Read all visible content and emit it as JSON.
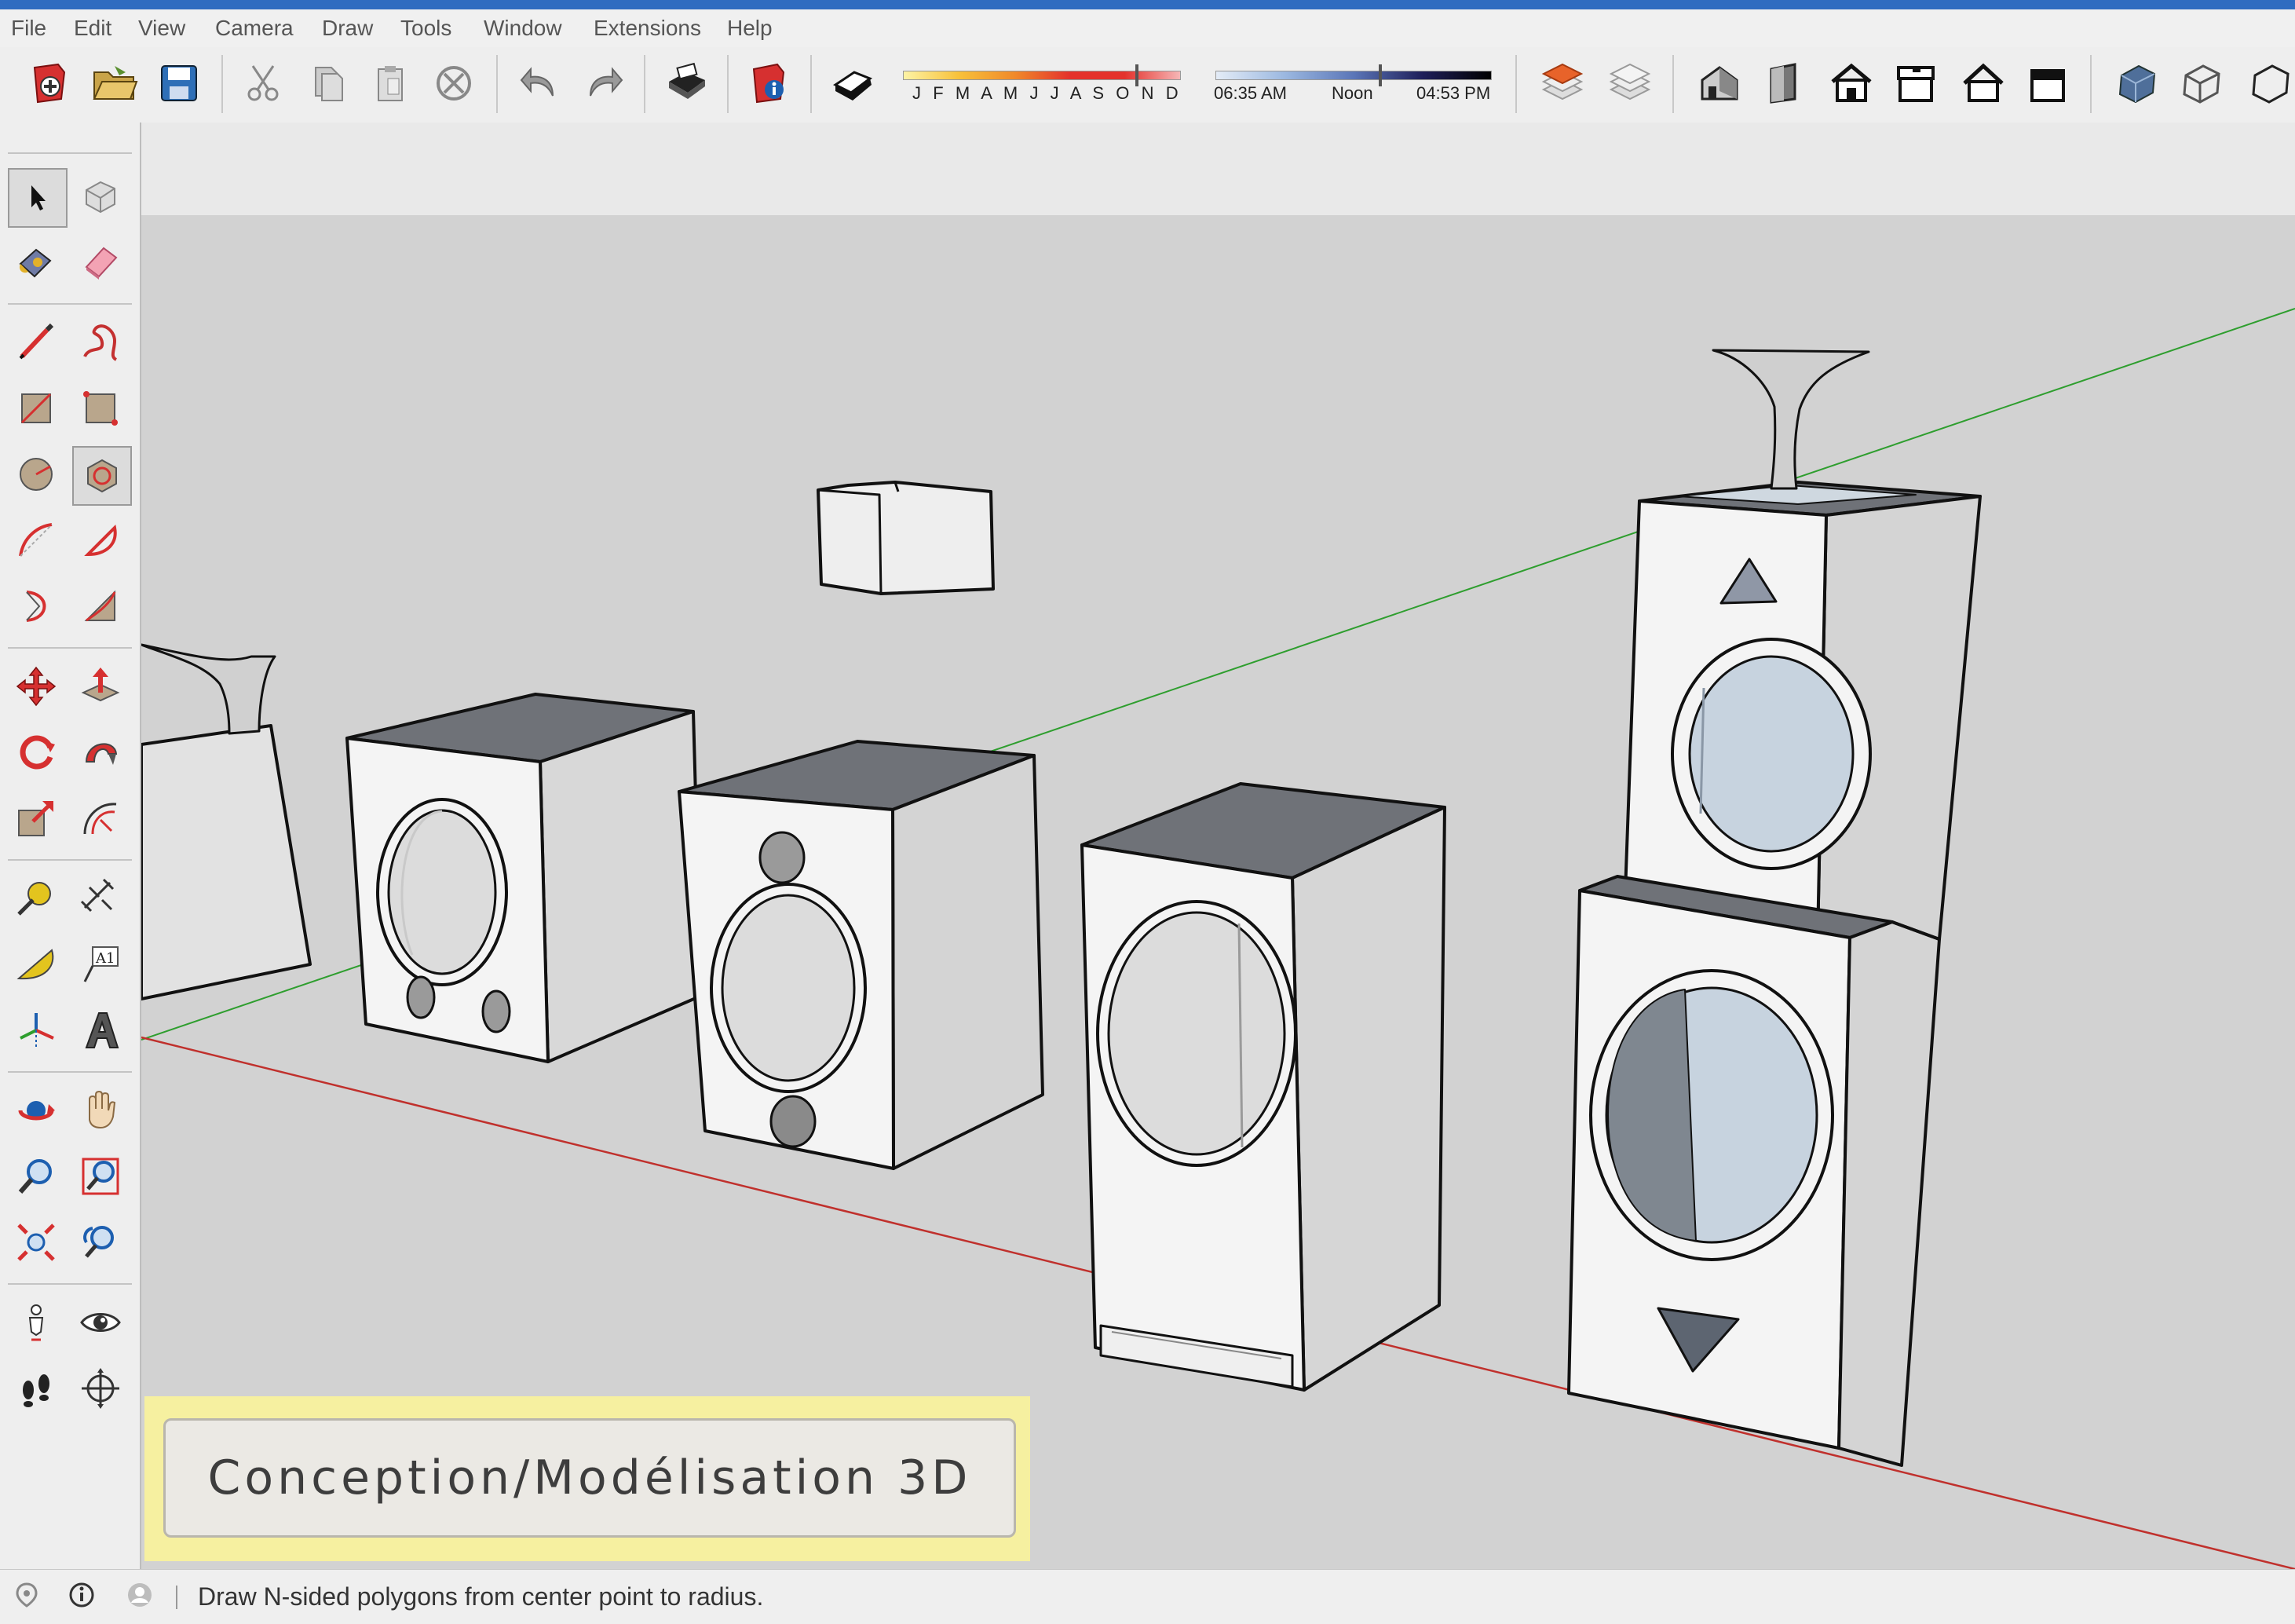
{
  "menu": [
    "File",
    "Edit",
    "View",
    "Camera",
    "Draw",
    "Tools",
    "Window",
    "Extensions",
    "Help"
  ],
  "toolbar": {
    "shadow_months": "J  F  M  A  M  J  J  A  S  O  N  D",
    "time_start": "06:35 AM",
    "time_noon": "Noon",
    "time_end": "04:53 PM",
    "icons": [
      "new-icon",
      "open-icon",
      "save-icon",
      "cut-icon",
      "copy-icon",
      "paste-icon",
      "erase-icon",
      "undo-icon",
      "redo-icon",
      "print-icon",
      "model-info-icon",
      "shadows-icon",
      "layers-icon",
      "layer-manager-icon",
      "iso-view-icon",
      "top-view-icon",
      "front-view-icon",
      "right-view-icon",
      "back-view-icon",
      "left-view-icon",
      "xray-icon",
      "wireframe-icon",
      "hidden-line-icon"
    ]
  },
  "left_tools": [
    "select",
    "component",
    "paint-bucket",
    "eraser",
    "line",
    "freehand",
    "rectangle",
    "rotated-rectangle",
    "circle",
    "polygon",
    "arc",
    "pie",
    "two-point-arc",
    "three-point-arc",
    "move",
    "push-pull",
    "rotate",
    "follow-me",
    "scale",
    "offset",
    "tape-measure",
    "dimension",
    "protractor",
    "text",
    "axes",
    "3d-text",
    "orbit",
    "pan",
    "zoom",
    "zoom-window",
    "zoom-extents",
    "previous",
    "position-camera",
    "look-around",
    "walk",
    "section-plane"
  ],
  "caption": "Conception/Modélisation 3D",
  "status": {
    "text": "Draw N-sided polygons from center point to radius."
  },
  "colors": {
    "red_axis": "#c0302c",
    "green_axis": "#2e9e2e",
    "accent": "#d63030"
  }
}
